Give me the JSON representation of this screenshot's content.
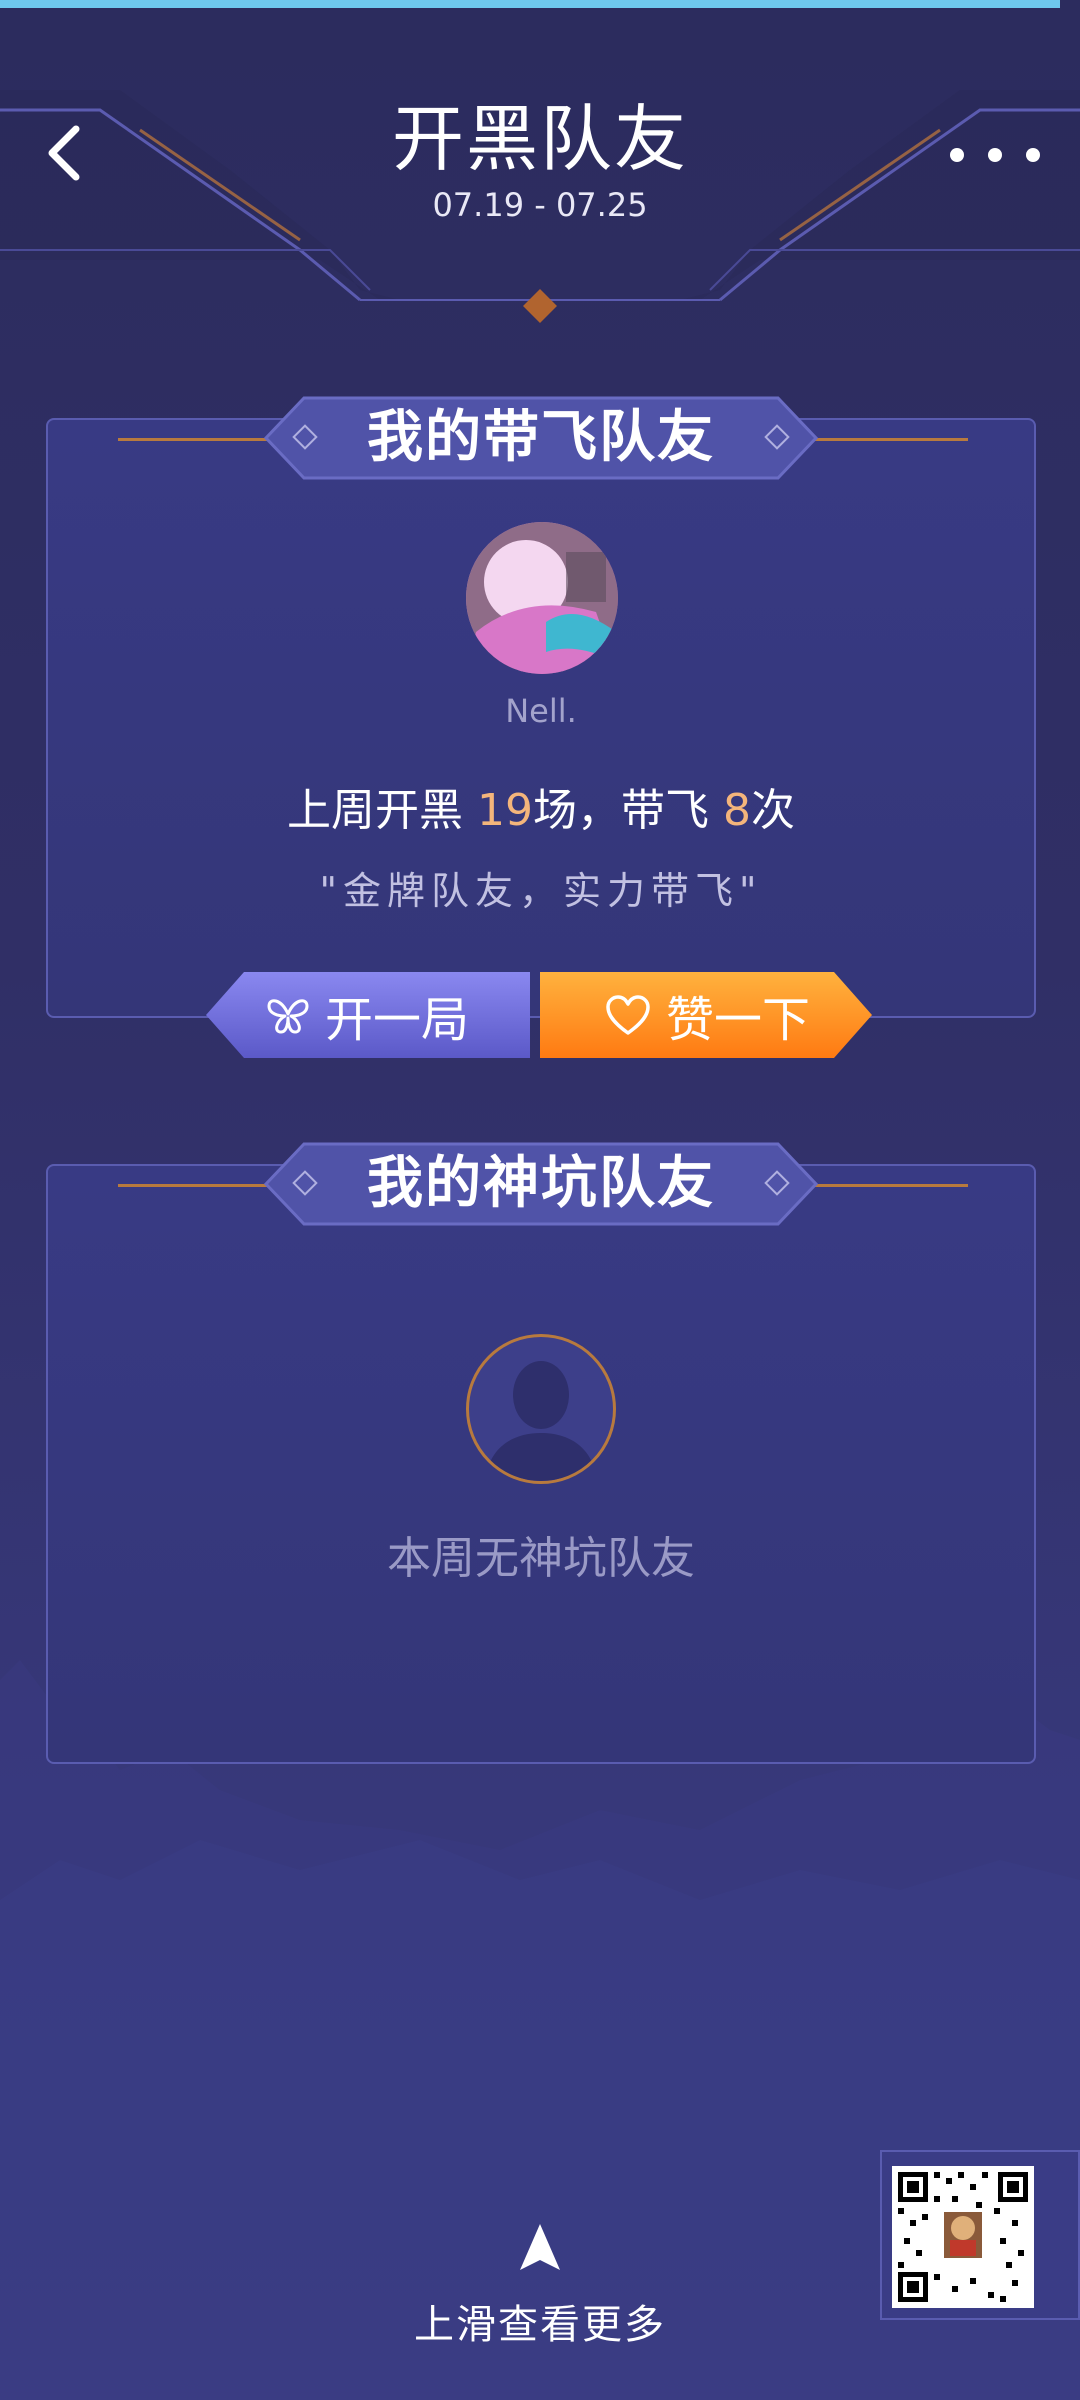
{
  "header": {
    "title": "开黑队友",
    "date_range": "07.19 - 07.25",
    "back_icon": "chevron-left-icon",
    "more_icon": "more-dots-icon"
  },
  "carry_card": {
    "title": "我的带飞队友",
    "nickname": "Nell.",
    "stats_prefix": "上周开黑 ",
    "games": "19",
    "stats_mid": "场，带飞 ",
    "carries": "8",
    "stats_suffix": "次",
    "quote": "\"金牌队友，实力带飞\"",
    "start_button": {
      "label": "开一局",
      "icon": "butterfly-icon"
    },
    "like_button": {
      "label": "赞一下",
      "icon": "heart-icon"
    }
  },
  "pit_card": {
    "title": "我的神坑队友",
    "empty_text": "本周无神坑队友",
    "placeholder_icon": "person-silhouette-icon"
  },
  "footer": {
    "swipe_text": "上滑查看更多",
    "swipe_icon": "arrow-up-icon",
    "qr_icon": "qr-code-icon"
  },
  "colors": {
    "background": "#302f66",
    "accent_orange": "#f4b57b",
    "like_button": "#ff8a1c",
    "start_button": "#6d6bd8"
  }
}
